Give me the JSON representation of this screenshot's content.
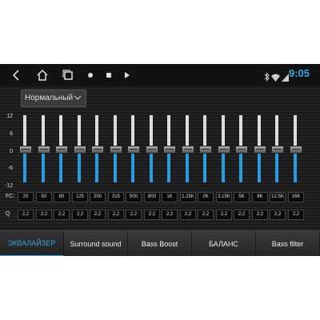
{
  "status": {
    "time": "9:05"
  },
  "nav": {
    "back": "back-icon",
    "home": "home-icon",
    "recent": "recent-apps-icon"
  },
  "preset": {
    "label": "Нормальный"
  },
  "scale": [
    "12",
    "6",
    "0",
    "-6",
    "-12"
  ],
  "rows": {
    "fc": "FC:",
    "q": "Q"
  },
  "bands": [
    {
      "fc": "20",
      "q": "2,2"
    },
    {
      "fc": "50",
      "q": "2,2"
    },
    {
      "fc": "80",
      "q": "2,2"
    },
    {
      "fc": "125",
      "q": "2,2"
    },
    {
      "fc": "200",
      "q": "2,2"
    },
    {
      "fc": "315",
      "q": "2,2"
    },
    {
      "fc": "500",
      "q": "2,2"
    },
    {
      "fc": "800",
      "q": "2,2"
    },
    {
      "fc": "1K",
      "q": "2,2"
    },
    {
      "fc": "1.25K",
      "q": "2,2"
    },
    {
      "fc": "2K",
      "q": "2,2"
    },
    {
      "fc": "3.15K",
      "q": "2,2"
    },
    {
      "fc": "5K",
      "q": "2,2"
    },
    {
      "fc": "8K",
      "q": "2,2"
    },
    {
      "fc": "12.5K",
      "q": "2,2"
    },
    {
      "fc": "16K",
      "q": "2,2"
    }
  ],
  "gain_db": 0,
  "tabs": [
    "ЭКВАЛАЙЗЕР",
    "Surround sound",
    "Bass Boost",
    "БАЛАНС",
    "Bass filter"
  ],
  "colors": {
    "accent": "#36a3e0",
    "fill": "#2a9de0"
  }
}
